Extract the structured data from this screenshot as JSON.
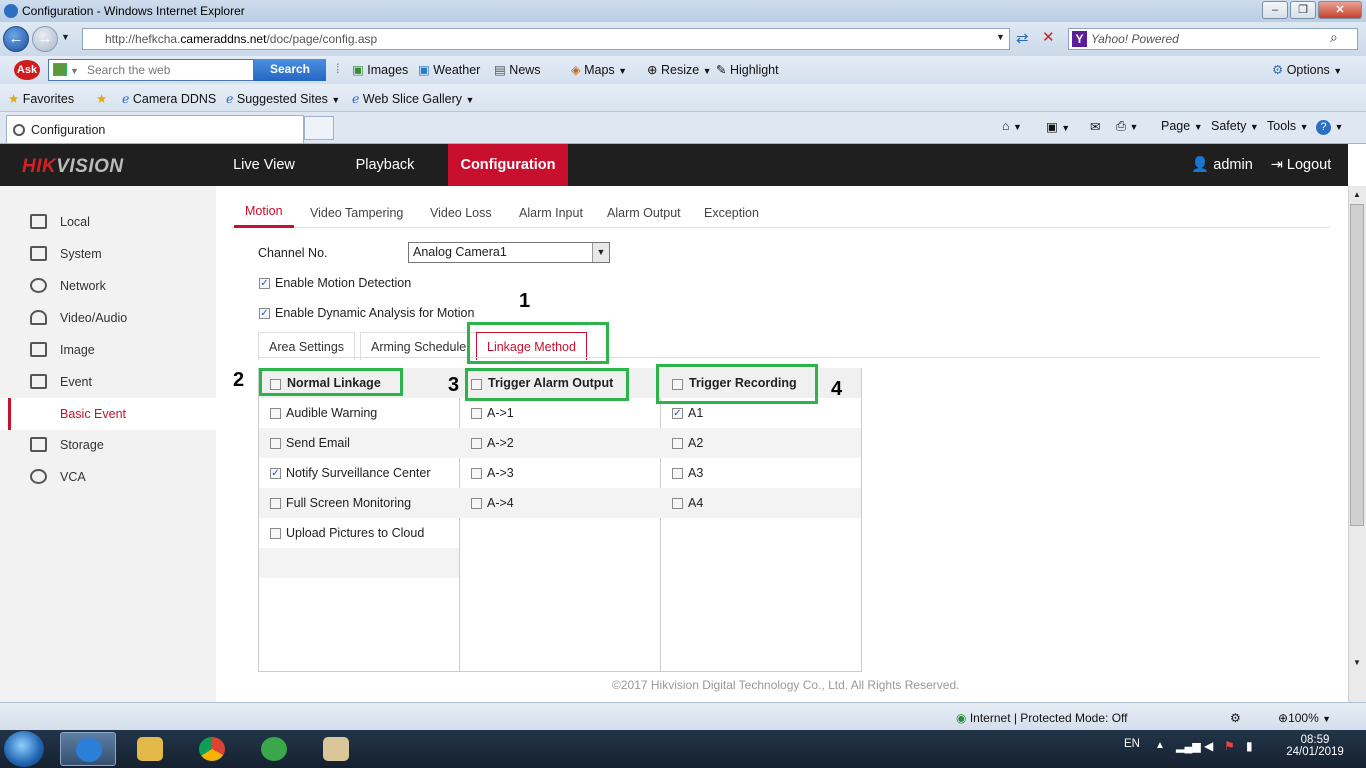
{
  "window": {
    "title": "Configuration - Windows Internet Explorer"
  },
  "browser": {
    "url_prefix": "http://hefkcha.",
    "url_host": "cameraddns.net",
    "url_path": "/doc/page/config.asp",
    "search_provider": "Yahoo! Powered"
  },
  "askbar": {
    "search_placeholder": "Search the web",
    "search_button": "Search",
    "items": [
      "Images",
      "Weather",
      "News",
      "Maps",
      "Resize",
      "Highlight"
    ],
    "options": "Options"
  },
  "favbar": {
    "favorites": "Favorites",
    "items": [
      "Camera DDNS",
      "Suggested Sites",
      "Web Slice Gallery"
    ]
  },
  "tabbar": {
    "active_tab": "Configuration",
    "commands": [
      "Page",
      "Safety",
      "Tools"
    ]
  },
  "app": {
    "logo_hik": "HIK",
    "logo_vision": "VISION",
    "nav": [
      "Live View",
      "Playback",
      "Configuration"
    ],
    "user": "admin",
    "logout": "Logout"
  },
  "sidebar": {
    "items": [
      "Local",
      "System",
      "Network",
      "Video/Audio",
      "Image",
      "Event",
      "Basic Event",
      "Storage",
      "VCA"
    ]
  },
  "subtabs": [
    "Motion",
    "Video Tampering",
    "Video Loss",
    "Alarm Input",
    "Alarm Output",
    "Exception"
  ],
  "form": {
    "channel_label": "Channel No.",
    "channel_value": "Analog Camera1",
    "enable_motion": "Enable Motion Detection",
    "enable_dynamic": "Enable Dynamic Analysis for Motion"
  },
  "linkage_tabs": [
    "Area Settings",
    "Arming Schedule",
    "Linkage Method"
  ],
  "linkage": {
    "normal_header": "Normal Linkage",
    "normal_items": [
      "Audible Warning",
      "Send Email",
      "Notify Surveillance Center",
      "Full Screen Monitoring",
      "Upload Pictures to Cloud"
    ],
    "alarm_header": "Trigger Alarm Output",
    "alarm_items": [
      "A->1",
      "A->2",
      "A->3",
      "A->4"
    ],
    "record_header": "Trigger Recording",
    "record_items": [
      "A1",
      "A2",
      "A3",
      "A4"
    ]
  },
  "annotations": [
    "1",
    "2",
    "3",
    "4"
  ],
  "footer": "©2017 Hikvision Digital Technology Co., Ltd. All Rights Reserved.",
  "status": {
    "zone": "Internet | Protected Mode: Off",
    "zoom": "100%"
  },
  "tray": {
    "lang": "EN",
    "time": "08:59",
    "date": "24/01/2019"
  },
  "colors": {
    "accent": "#c8102e",
    "highlight_box": "#2cb34a",
    "appbar": "#1f1f1f"
  }
}
